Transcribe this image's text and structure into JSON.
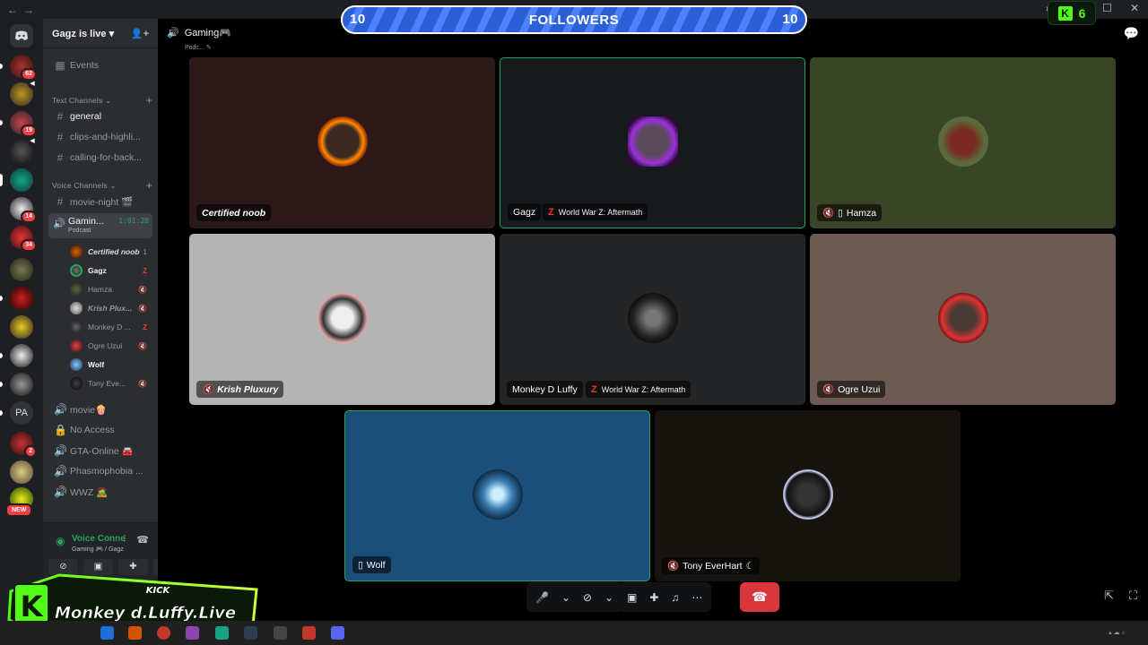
{
  "window": {
    "nav_back": "←",
    "nav_fwd": "→"
  },
  "colors": {
    "accent": "#23a55a",
    "danger": "#da373c",
    "kick": "#53fc18",
    "followers_bar": "#2a5fd6"
  },
  "server": {
    "name": "Gagz is live ▾"
  },
  "rail": {
    "badges": [
      "62",
      "19",
      "14",
      "34",
      "2"
    ],
    "pa_label": "PA",
    "new_label": "NEW"
  },
  "sidebar": {
    "events": "Events",
    "text_category": "Text Channels ⌄",
    "text_channels": [
      "general",
      "clips-and-highli...",
      "calling-for-back..."
    ],
    "voice_category": "Voice Channels ⌄",
    "movie_night": "movie-night 🎬",
    "active_voice": {
      "name": "Gamin...",
      "time": "1:01:28",
      "sub": "Podcast"
    },
    "members": [
      {
        "name": "Certified noob",
        "status": "1"
      },
      {
        "name": "Gagz",
        "status": "Z"
      },
      {
        "name": "Hamza",
        "status": "🔇"
      },
      {
        "name": "Krish Plux...",
        "status": "🔇"
      },
      {
        "name": "Monkey D ...",
        "status": "Z"
      },
      {
        "name": "Ogre Uzui",
        "status": "🔇"
      },
      {
        "name": "Wolf",
        "status": ""
      },
      {
        "name": "Tony Eve...",
        "status": "🔇"
      }
    ],
    "more_channels": [
      "movie🍿",
      "No Access",
      "GTA-Online 🚘",
      "Phasmophobia ...",
      "WWZ 🧟"
    ]
  },
  "voice_panel": {
    "status": "Voice Connected",
    "sub": "Gaming 🎮 / Gagz ..."
  },
  "stage": {
    "channel": "Gaming🎮",
    "channel_sub": "Podc... ✎",
    "tiles": [
      {
        "name": "Certified noob",
        "game": ""
      },
      {
        "name": "Gagz",
        "game": "World War Z: Aftermath"
      },
      {
        "name": "Hamza",
        "game": ""
      },
      {
        "name": "Krish Pluxury",
        "game": ""
      },
      {
        "name": "Monkey D Luffy",
        "game": "World War Z: Aftermath"
      },
      {
        "name": "Ogre Uzui",
        "game": ""
      },
      {
        "name": "Wolf",
        "game": ""
      },
      {
        "name": "Tony EverHart",
        "game": ""
      }
    ]
  },
  "overlay": {
    "followers_label": "FOLLOWERS",
    "followers_left": "10",
    "followers_right": "10",
    "kick_count": "6",
    "logo_line1": "KICK",
    "logo_line2": "Monkey d.Luffy.Live"
  }
}
